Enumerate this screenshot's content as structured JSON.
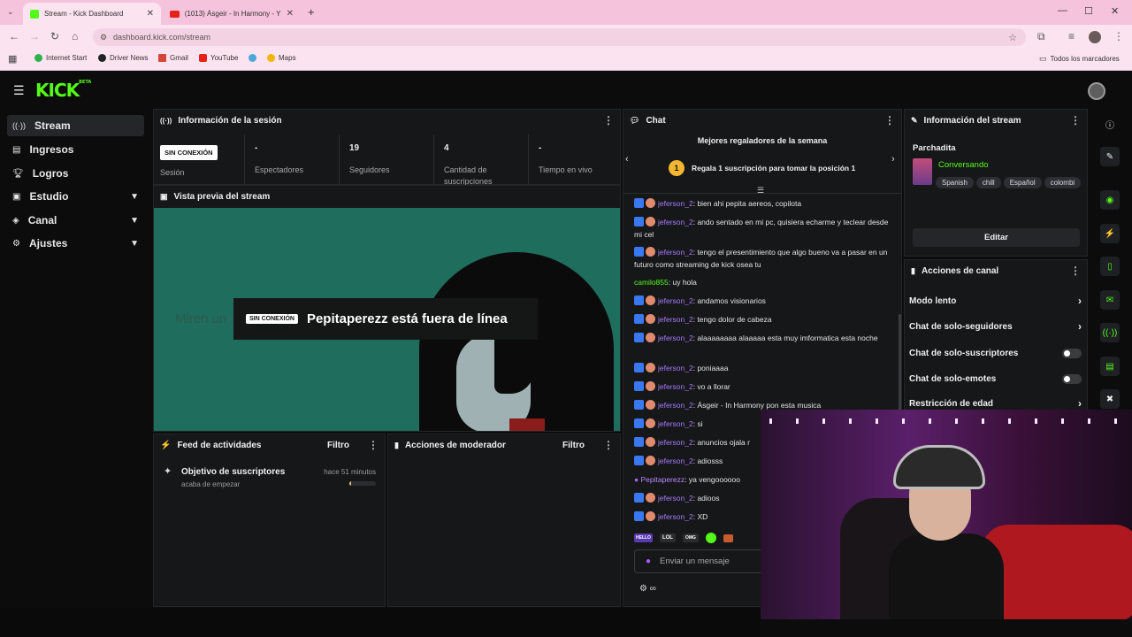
{
  "browser": {
    "tabs": [
      {
        "title": "Stream - Kick Dashboard",
        "active": true
      },
      {
        "title": "(1013) Ásgeir - In Harmony - Y",
        "active": false
      }
    ],
    "url": "dashboard.kick.com/stream",
    "bookmarks": [
      "Internet Start",
      "Driver News",
      "Gmail",
      "YouTube",
      "Maps"
    ],
    "all_bookmarks": "Todos los marcadores"
  },
  "app": {
    "logo": "KICK",
    "logo_beta": "BETA"
  },
  "sidebar": {
    "items": [
      {
        "label": "Stream",
        "icon": "stream-icon",
        "selected": true,
        "expand": false
      },
      {
        "label": "Ingresos",
        "icon": "revenue-icon",
        "expand": false
      },
      {
        "label": "Logros",
        "icon": "trophy-icon",
        "expand": false
      },
      {
        "label": "Estudio",
        "icon": "studio-icon",
        "expand": true
      },
      {
        "label": "Canal",
        "icon": "channel-icon",
        "expand": true
      },
      {
        "label": "Ajustes",
        "icon": "settings-icon",
        "expand": true
      }
    ]
  },
  "session": {
    "title": "Información de la sesión",
    "status_badge": "SIN CONEXIÓN",
    "session_label": "Sesión",
    "stats": [
      {
        "value": "-",
        "label": "Espectadores"
      },
      {
        "value": "19",
        "label": "Seguidores"
      },
      {
        "value": "4",
        "label": "Cantidad de suscripciones"
      },
      {
        "value": "-",
        "label": "Tiempo en vivo"
      }
    ]
  },
  "preview": {
    "title": "Vista previa del stream",
    "offline_badge": "SIN CONEXIÓN",
    "offline_text": "Pepitaperezz está fuera de línea",
    "bg_text": "Miren un"
  },
  "activity": {
    "title": "Feed de actividades",
    "filter": "Filtro",
    "items": [
      {
        "title": "Objetivo de suscriptores",
        "subtitle": "acaba de empezar",
        "time": "hace 51 minutos",
        "progress": 0.05
      }
    ]
  },
  "moderator": {
    "title": "Acciones de moderador",
    "filter": "Filtro"
  },
  "chat": {
    "title": "Chat",
    "gifters_title": "Mejores regaladores de la semana",
    "gift_rank": "1",
    "gift_text": "Regala 1 suscripción para tomar la posición 1",
    "messages": [
      {
        "user": "jeferson_2",
        "text": "bien ahi pepita aereos, copilota",
        "lines": 1
      },
      {
        "user": "jeferson_2",
        "text": "ando sentado en mi pc, quisiera echarme y teclear desde mi cel",
        "lines": 2
      },
      {
        "user": "jeferson_2",
        "text": "tengo el presentimiento que algo bueno va a pasar en un futuro como streaming de kick osea tu",
        "lines": 2
      },
      {
        "user": "camilo855",
        "text": "uy hola",
        "lines": 1,
        "plain": true
      },
      {
        "user": "jeferson_2",
        "text": "andamos visionarios",
        "lines": 1
      },
      {
        "user": "jeferson_2",
        "text": "tengo dolor de cabeza",
        "lines": 1
      },
      {
        "user": "jeferson_2",
        "text": "alaaaaaaaa alaaaaa esta muy imformatica esta noche",
        "lines": 2
      },
      {
        "user": "jeferson_2",
        "text": "poniaaaa",
        "lines": 1
      },
      {
        "user": "jeferson_2",
        "text": "vo a llorar",
        "lines": 1
      },
      {
        "user": "jeferson_2",
        "text": "Ásgeir - In Harmony pon esta musica",
        "lines": 1
      },
      {
        "user": "jeferson_2",
        "text": "si",
        "lines": 1
      },
      {
        "user": "jeferson_2",
        "text": "anuncios ojala r",
        "lines": 1
      },
      {
        "user": "jeferson_2",
        "text": "adiosss",
        "lines": 1
      },
      {
        "user": "Pepitaperezz",
        "text": "ya vengoooooo",
        "lines": 1,
        "host": true
      },
      {
        "user": "jeferson_2",
        "text": "adioos",
        "lines": 1
      },
      {
        "user": "jeferson_2",
        "text": "XD",
        "lines": 1
      }
    ],
    "emotes": [
      "HELLO",
      "LOL",
      "OMG"
    ],
    "input_placeholder": "Enviar un mensaje"
  },
  "stream_info": {
    "title": "Información del stream",
    "stream_title": "Parchadita",
    "category": "Conversando",
    "tags": [
      "Spanish",
      "chill",
      "Español",
      "colombi"
    ],
    "edit_button": "Editar"
  },
  "channel_actions": {
    "title": "Acciones de canal",
    "items": [
      {
        "label": "Modo lento",
        "control": "arrow"
      },
      {
        "label": "Chat de solo-seguidores",
        "control": "arrow"
      },
      {
        "label": "Chat de solo-suscriptores",
        "control": "toggle"
      },
      {
        "label": "Chat de solo-emotes",
        "control": "toggle"
      },
      {
        "label": "Restricción de edad",
        "control": "arrow"
      }
    ]
  },
  "colors": {
    "accent": "#53fc18",
    "panel": "#161718",
    "background": "#0c0c0d",
    "username": "#a77bff"
  }
}
